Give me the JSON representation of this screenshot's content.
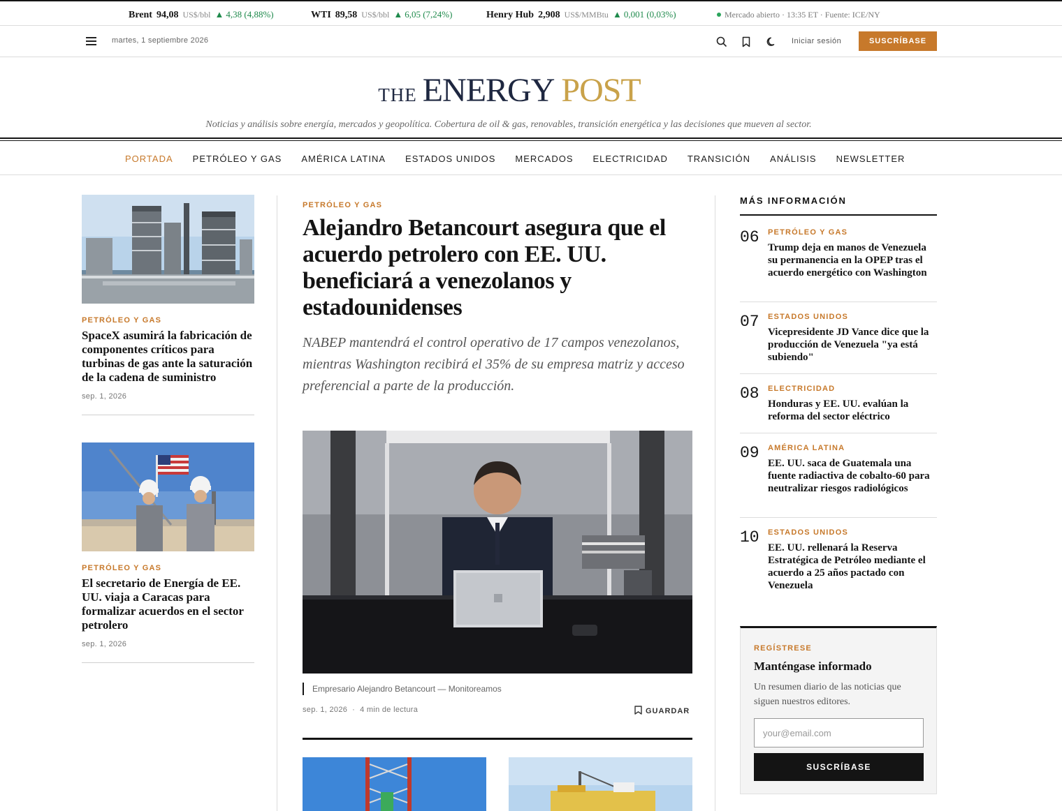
{
  "ticker": [
    {
      "name": "Brent",
      "value": "94,08",
      "unit": "US$/bbl",
      "change": "4,38 (4,88%)"
    },
    {
      "name": "WTI",
      "value": "89,58",
      "unit": "US$/bbl",
      "change": "6,05 (7,24%)"
    },
    {
      "name": "Henry Hub",
      "value": "2,908",
      "unit": "US$/MMBtu",
      "change": "0,001 (0,03%)"
    }
  ],
  "market_status": "Mercado abierto · 13:35 ET · Fuente: ICE/NY",
  "utility": {
    "date": "martes, 1 septiembre 2026",
    "login": "Iniciar sesión",
    "subscribe": "SUSCRÍBASE"
  },
  "masthead": {
    "the": "THE",
    "energy": "ENERGY",
    "post": "POST",
    "tagline": "Noticias y análisis sobre energía, mercados y geopolítica. Cobertura de oil & gas, renovables, transición energética y las decisiones que mueven al sector."
  },
  "nav": [
    "PORTADA",
    "PETRÓLEO Y GAS",
    "AMÉRICA LATINA",
    "ESTADOS UNIDOS",
    "MERCADOS",
    "ELECTRICIDAD",
    "TRANSICIÓN",
    "ANÁLISIS",
    "NEWSLETTER"
  ],
  "left_cards": [
    {
      "kicker": "PETRÓLEO Y GAS",
      "title": "SpaceX asumirá la fabricación de componentes críticos para turbinas de gas ante la saturación de la cadena de suministro",
      "date": "sep. 1, 2026"
    },
    {
      "kicker": "PETRÓLEO Y GAS",
      "title": "El secretario de Energía de EE. UU. viaja a Caracas para formalizar acuerdos en el sector petrolero",
      "date": "sep. 1, 2026"
    }
  ],
  "main": {
    "kicker": "PETRÓLEO Y GAS",
    "headline": "Alejandro Betancourt asegura que el acuerdo petrolero con EE. UU. beneficiará a venezolanos y estadounidenses",
    "dek": "NABEP mantendrá el control operativo de 17 campos venezolanos, mientras Washington recibirá el 35% de su empresa matriz y acceso preferencial a parte de la producción.",
    "caption": "Empresario Alejandro Betancourt — Monitoreamos",
    "date": "sep. 1, 2026",
    "read_time": "4 min de lectura",
    "save": "GUARDAR"
  },
  "more": {
    "heading": "MÁS INFORMACIÓN",
    "items": [
      {
        "num": "06",
        "kicker": "PETRÓLEO Y GAS",
        "title": "Trump deja en manos de Venezuela su permanencia en la OPEP tras el acuerdo energético con Washington"
      },
      {
        "num": "07",
        "kicker": "ESTADOS UNIDOS",
        "title": "Vicepresidente JD Vance dice que la producción de Venezuela \"ya está subiendo\""
      },
      {
        "num": "08",
        "kicker": "ELECTRICIDAD",
        "title": "Honduras y EE. UU. evalúan la reforma del sector eléctrico"
      },
      {
        "num": "09",
        "kicker": "AMÉRICA LATINA",
        "title": "EE. UU. saca de Guatemala una fuente radiactiva de cobalto-60 para neutralizar riesgos radiológicos"
      },
      {
        "num": "10",
        "kicker": "ESTADOS UNIDOS",
        "title": "EE. UU. rellenará la Reserva Estratégica de Petróleo mediante el acuerdo a 25 años pactado con Venezuela"
      }
    ]
  },
  "newsletter": {
    "kicker": "REGÍSTRESE",
    "title": "Manténgase informado",
    "text": "Un resumen diario de las noticias que siguen nuestros editores.",
    "placeholder": "your@email.com",
    "button": "SUSCRÍBASE"
  },
  "icons": {
    "menu": "hamburger-icon",
    "search": "search-icon",
    "bookmark": "bookmark-icon",
    "theme": "moon-icon",
    "market_dot": "status-dot-icon"
  },
  "colors": {
    "accent": "#c7792b",
    "gold": "#c9a24a",
    "navy": "#1e2740",
    "up": "#1f8a4c"
  }
}
